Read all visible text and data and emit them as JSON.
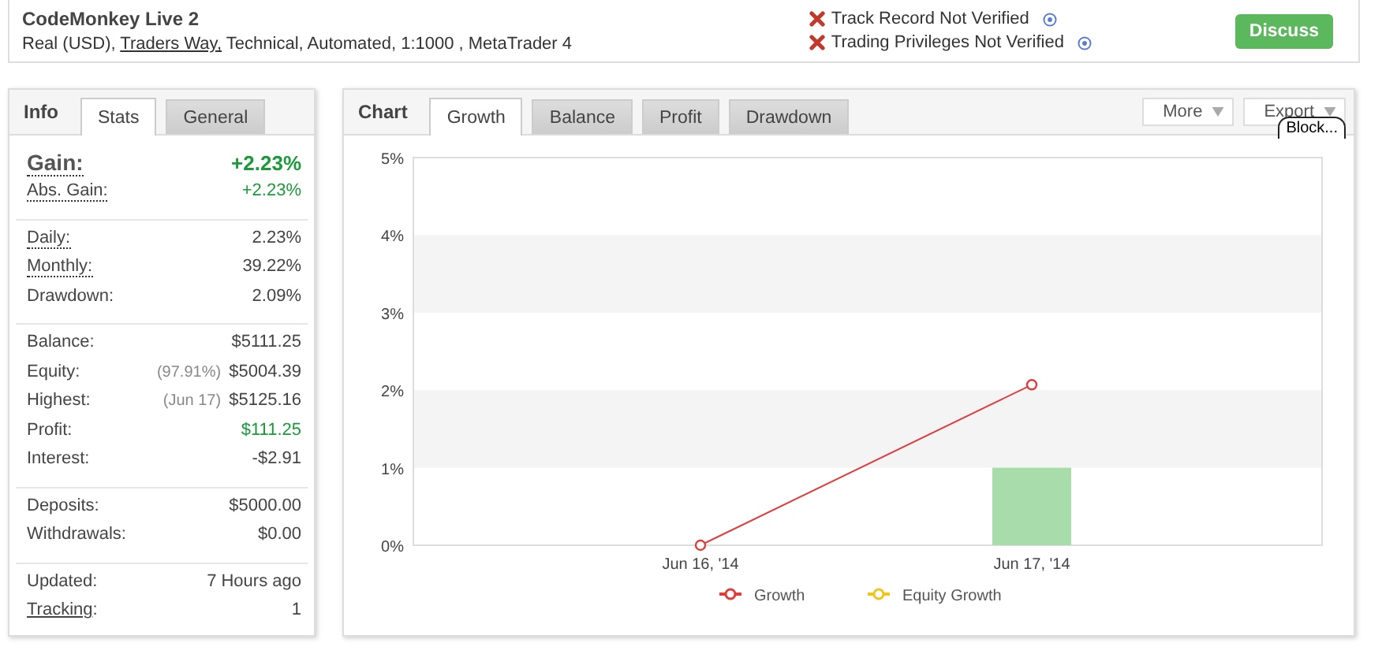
{
  "header": {
    "title": "CodeMonkey Live 2",
    "details": [
      {
        "text": "Real (USD), ",
        "link": false
      },
      {
        "text": "Traders Way,",
        "link": true
      },
      {
        "text": " Technical, Automated, 1:1000 , MetaTrader 4",
        "link": false
      }
    ],
    "warnings": [
      {
        "text": "Track Record Not Verified"
      },
      {
        "text": "Trading Privileges Not Verified"
      }
    ],
    "discuss_button": "Discuss"
  },
  "info": {
    "title": "Info",
    "tabs": [
      {
        "label": "Stats",
        "selected": true
      },
      {
        "label": "General",
        "selected": false
      }
    ],
    "groups": [
      [
        {
          "label": "Gain:",
          "value": "+2.23%",
          "dotted": true,
          "headline": true,
          "positive": true
        },
        {
          "label": "Abs. Gain:",
          "value": "+2.23%",
          "dotted": true,
          "headline": false,
          "positive": true
        }
      ],
      [
        {
          "label": "Daily:",
          "value": "2.23%",
          "dotted": true,
          "headline": false,
          "positive": false
        },
        {
          "label": "Monthly:",
          "value": "39.22%",
          "dotted": true,
          "headline": false,
          "positive": false
        },
        {
          "label": "Drawdown:",
          "value": "2.09%",
          "dotted": false,
          "headline": false,
          "positive": false
        }
      ],
      [
        {
          "label": "Balance:",
          "value": "$5111.25",
          "dotted": false,
          "headline": false,
          "positive": false
        },
        {
          "label": "Equity:",
          "note": "(97.91%)",
          "value": "$5004.39",
          "dotted": false,
          "headline": false,
          "positive": false
        },
        {
          "label": "Highest:",
          "note": "(Jun 17)",
          "value": "$5125.16",
          "dotted": false,
          "headline": false,
          "positive": false
        },
        {
          "label": "Profit:",
          "value": "$111.25",
          "dotted": false,
          "headline": false,
          "positive": true
        },
        {
          "label": "Interest:",
          "value": "-$2.91",
          "dotted": false,
          "headline": false,
          "positive": false
        }
      ],
      [
        {
          "label": "Deposits:",
          "value": "$5000.00",
          "dotted": false,
          "headline": false,
          "positive": false
        },
        {
          "label": "Withdrawals:",
          "value": "$0.00",
          "dotted": false,
          "headline": false,
          "positive": false
        }
      ],
      [
        {
          "label": "Updated:",
          "value": "7 Hours ago",
          "dotted": false,
          "headline": false,
          "positive": false
        },
        {
          "label": "Tracking",
          "suffix": ":",
          "value": "1",
          "dotted": false,
          "link": true,
          "headline": false,
          "positive": false
        }
      ]
    ]
  },
  "chart": {
    "title": "Chart",
    "tabs": [
      {
        "label": "Growth",
        "selected": true
      },
      {
        "label": "Balance",
        "selected": false
      },
      {
        "label": "Profit",
        "selected": false
      },
      {
        "label": "Drawdown",
        "selected": false
      }
    ],
    "menus": [
      {
        "label": "More"
      },
      {
        "label": "Export"
      }
    ],
    "tooltip": "Block...",
    "chart_data": {
      "type": "line",
      "categories": [
        "Jun 16, '14",
        "Jun 17, '14"
      ],
      "ylim": [
        0,
        5
      ],
      "yticks": [
        {
          "value": 0,
          "label": "0%"
        },
        {
          "value": 1,
          "label": "1%"
        },
        {
          "value": 2,
          "label": "2%"
        },
        {
          "value": 3,
          "label": "3%"
        },
        {
          "value": 4,
          "label": "4%"
        },
        {
          "value": 5,
          "label": "5%"
        }
      ],
      "series": [
        {
          "name": "Growth",
          "color": "#e03c3c",
          "marker": "o",
          "values": [
            0,
            2.07
          ]
        },
        {
          "name": "Equity Growth",
          "color": "#f0c419",
          "marker": "o",
          "values": [
            null,
            null
          ]
        },
        {
          "type": "bar",
          "color": "#a8dcaa",
          "values": [
            null,
            1
          ]
        }
      ]
    }
  }
}
